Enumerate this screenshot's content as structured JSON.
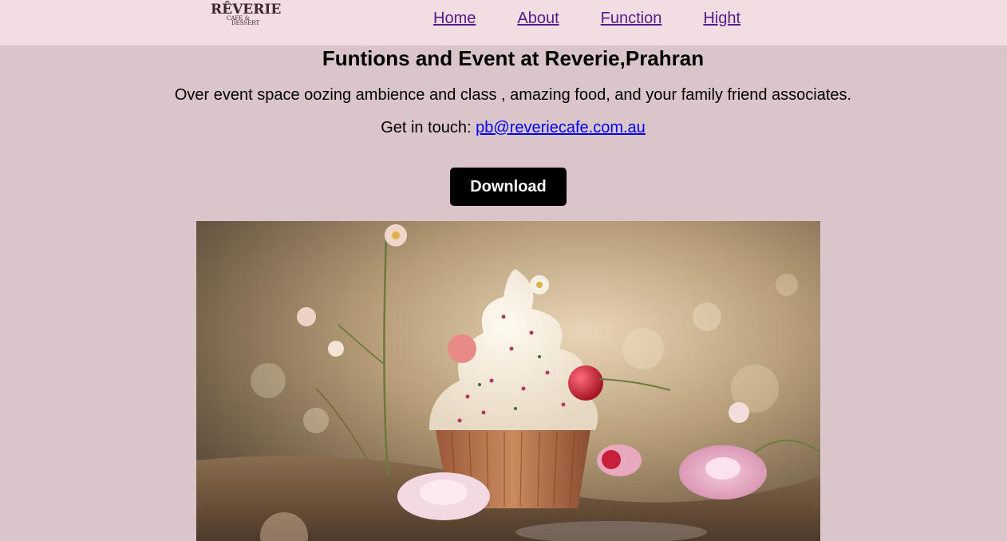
{
  "nav": {
    "logo_text": "RÊVERIE",
    "logo_subtext_1": "CAFE &",
    "logo_subtext_2": "DESSERT",
    "links": [
      "Home",
      "About",
      "Function",
      "Hight"
    ]
  },
  "main": {
    "title": "Funtions and Event at Reverie,Prahran",
    "tagline": "Over event space oozing ambience and class , amazing food, and your family friend associates.",
    "contact_prefix": "Get in touch: ",
    "contact_email": "pb@reveriecafe.com.au",
    "download_label": "Download"
  },
  "image": {
    "subject": "cupcake-with-cream-and-cherry-among-flowers"
  },
  "colors": {
    "navbar_bg": "#f1dde2",
    "page_bg": "#d9c5ca",
    "link_visited": "#551a8b",
    "link": "#0000ee",
    "button_bg": "#000000"
  }
}
